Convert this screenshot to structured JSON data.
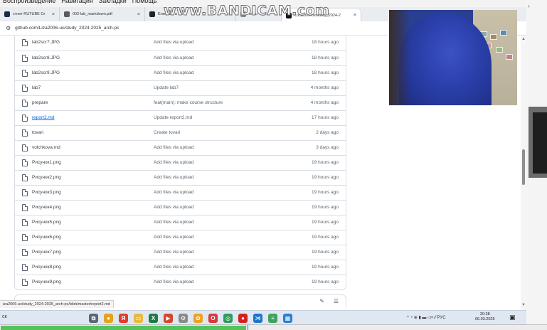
{
  "menubar": [
    "Воспроизведение",
    "Навигация",
    "Закладки",
    "Помощь"
  ],
  "tabs": [
    {
      "title": "стнет RUTUBE Смотр",
      "icon": "rutube-icon",
      "color": "#1c2a4a"
    },
    {
      "title": "002-lab_markdown.pdf",
      "icon": "pdf-icon",
      "color": "#5a5a5a"
    },
    {
      "title": "Елизавета Бо",
      "icon": "tab-icon",
      "color": "#222222"
    },
    {
      "title": "u/stu",
      "icon": "tab-icon",
      "color": "#888888"
    },
    {
      "title": "Liza2006-ux/study_2024-2",
      "icon": "github-icon",
      "color": "#111111",
      "active": true
    }
  ],
  "address": {
    "url": "github.com/Liza2006-ux/study_2024-2025_arch-pc"
  },
  "watermark": "www.BANDICAM.com",
  "files": [
    {
      "name": "lab2scr7.JPG",
      "commit": "Add files via upload",
      "age": "18 hours ago"
    },
    {
      "name": "lab2scr8.JPG",
      "commit": "Add files via upload",
      "age": "18 hours ago"
    },
    {
      "name": "lab2scr9.JPG",
      "commit": "Add files via upload",
      "age": "18 hours ago"
    },
    {
      "name": "lab7",
      "commit": "Update lab7",
      "age": "4 months ago"
    },
    {
      "name": "prepare",
      "commit": "feat(main): make course structure",
      "age": "4 months ago"
    },
    {
      "name": "report2.md",
      "commit": "Update report2.md",
      "age": "17 hours ago",
      "link": true
    },
    {
      "name": "tovari",
      "commit": "Create tovari",
      "age": "2 days ago"
    },
    {
      "name": "volchkova.md",
      "commit": "Add files via upload",
      "age": "3 days ago"
    },
    {
      "name": "Рисунок1.png",
      "commit": "Add files via upload",
      "age": "19 hours ago"
    },
    {
      "name": "Рисунок2.png",
      "commit": "Add files via upload",
      "age": "19 hours ago"
    },
    {
      "name": "Рисунок3.png",
      "commit": "Add files via upload",
      "age": "19 hours ago"
    },
    {
      "name": "Рисунок4.png",
      "commit": "Add files via upload",
      "age": "19 hours ago"
    },
    {
      "name": "Рисунок5.png",
      "commit": "Add files via upload",
      "age": "19 hours ago"
    },
    {
      "name": "Рисунок6.png",
      "commit": "Add files via upload",
      "age": "19 hours ago"
    },
    {
      "name": "Рисунок7.png",
      "commit": "Add files via upload",
      "age": "19 hours ago"
    },
    {
      "name": "Рисунок8.png",
      "commit": "Add files via upload",
      "age": "19 hours ago"
    },
    {
      "name": "Рисунок9.png",
      "commit": "Add files via upload",
      "age": "19 hours ago"
    }
  ],
  "status_url": "iza2006-ux/study_2024-2025_arch-pc/blob/master/report2.md",
  "taskbar": {
    "search": "ск",
    "apps": [
      {
        "name": "task-view-icon",
        "color": "#5b6472",
        "glyph": "⧉"
      },
      {
        "name": "chrome-icon",
        "color": "#e5a21a",
        "glyph": "●"
      },
      {
        "name": "yandex-icon",
        "color": "#e23b2e",
        "glyph": "Я"
      },
      {
        "name": "explorer-icon",
        "color": "#e8b93a",
        "glyph": "▭"
      },
      {
        "name": "excel-icon",
        "color": "#1f7a43",
        "glyph": "X"
      },
      {
        "name": "video-editor-icon",
        "color": "#d9442b",
        "glyph": "▶"
      },
      {
        "name": "settings-icon",
        "color": "#8a8a8a",
        "glyph": "⚙"
      },
      {
        "name": "color-app-icon",
        "color": "#f0a020",
        "glyph": "✿"
      },
      {
        "name": "opera-icon",
        "color": "#d63a3a",
        "glyph": "O"
      },
      {
        "name": "green-app-icon",
        "color": "#2e9a5a",
        "glyph": "◎"
      },
      {
        "name": "record-icon",
        "color": "#d62020",
        "glyph": "●"
      },
      {
        "name": "vscode-icon",
        "color": "#1f74c9",
        "glyph": "⋊"
      },
      {
        "name": "docs-icon",
        "color": "#3da35d",
        "glyph": "≡"
      },
      {
        "name": "photos-icon",
        "color": "#2b7fcf",
        "glyph": "▦"
      }
    ],
    "tray": "^ ◔ ⊕ ▮ ▬ ◁× ⁄⁄ РУС",
    "time": "20:38",
    "date": "06.03.2025"
  },
  "progress": {
    "fraction": 0.45
  }
}
